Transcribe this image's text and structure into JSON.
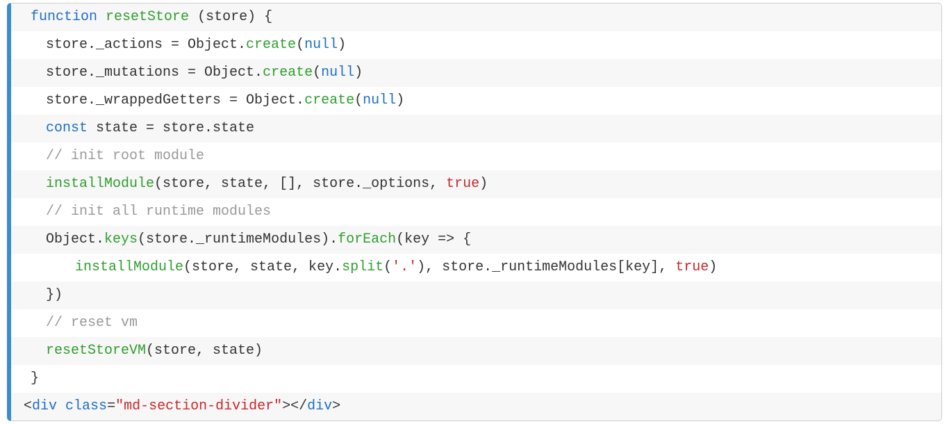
{
  "code": {
    "lines": [
      {
        "indent": "indent0",
        "tokens": [
          {
            "cls": "tok-keyword",
            "text": "function"
          },
          {
            "cls": "",
            "text": " "
          },
          {
            "cls": "tok-func",
            "text": "resetStore"
          },
          {
            "cls": "",
            "text": " ("
          },
          {
            "cls": "",
            "text": "store"
          },
          {
            "cls": "",
            "text": ") {"
          }
        ]
      },
      {
        "indent": "indent1",
        "tokens": [
          {
            "cls": "",
            "text": "store._actions = Object."
          },
          {
            "cls": "tok-func",
            "text": "create"
          },
          {
            "cls": "",
            "text": "("
          },
          {
            "cls": "tok-null",
            "text": "null"
          },
          {
            "cls": "",
            "text": ")"
          }
        ]
      },
      {
        "indent": "indent1",
        "tokens": [
          {
            "cls": "",
            "text": "store._mutations = Object."
          },
          {
            "cls": "tok-func",
            "text": "create"
          },
          {
            "cls": "",
            "text": "("
          },
          {
            "cls": "tok-null",
            "text": "null"
          },
          {
            "cls": "",
            "text": ")"
          }
        ]
      },
      {
        "indent": "indent1",
        "tokens": [
          {
            "cls": "",
            "text": "store._wrappedGetters = Object."
          },
          {
            "cls": "tok-func",
            "text": "create"
          },
          {
            "cls": "",
            "text": "("
          },
          {
            "cls": "tok-null",
            "text": "null"
          },
          {
            "cls": "",
            "text": ")"
          }
        ]
      },
      {
        "indent": "indent1",
        "tokens": [
          {
            "cls": "tok-keyword",
            "text": "const"
          },
          {
            "cls": "",
            "text": " state = store.state"
          }
        ]
      },
      {
        "indent": "indent1",
        "tokens": [
          {
            "cls": "tok-comment",
            "text": "// init root module"
          }
        ]
      },
      {
        "indent": "indent1",
        "tokens": [
          {
            "cls": "tok-func",
            "text": "installModule"
          },
          {
            "cls": "",
            "text": "(store, state, [], store._options, "
          },
          {
            "cls": "tok-bool",
            "text": "true"
          },
          {
            "cls": "",
            "text": ")"
          }
        ]
      },
      {
        "indent": "indent1",
        "tokens": [
          {
            "cls": "tok-comment",
            "text": "// init all runtime modules"
          }
        ]
      },
      {
        "indent": "indent1",
        "tokens": [
          {
            "cls": "",
            "text": "Object."
          },
          {
            "cls": "tok-func",
            "text": "keys"
          },
          {
            "cls": "",
            "text": "(store._runtimeModules)."
          },
          {
            "cls": "tok-func",
            "text": "forEach"
          },
          {
            "cls": "",
            "text": "(key => {"
          }
        ]
      },
      {
        "indent": "indent2",
        "tokens": [
          {
            "cls": "tok-func",
            "text": "installModule"
          },
          {
            "cls": "",
            "text": "(store, state, key."
          },
          {
            "cls": "tok-func",
            "text": "split"
          },
          {
            "cls": "",
            "text": "("
          },
          {
            "cls": "tok-string",
            "text": "'.'"
          },
          {
            "cls": "",
            "text": "), store._runtimeModules[key], "
          },
          {
            "cls": "tok-bool",
            "text": "true"
          },
          {
            "cls": "",
            "text": ")"
          }
        ]
      },
      {
        "indent": "indent1",
        "tokens": [
          {
            "cls": "",
            "text": "})"
          }
        ]
      },
      {
        "indent": "indent1",
        "tokens": [
          {
            "cls": "tok-comment",
            "text": "// reset vm"
          }
        ]
      },
      {
        "indent": "indent1",
        "tokens": [
          {
            "cls": "tok-func",
            "text": "resetStoreVM"
          },
          {
            "cls": "",
            "text": "(store, state)"
          }
        ]
      },
      {
        "indent": "indent0",
        "tokens": [
          {
            "cls": "",
            "text": "}"
          }
        ]
      },
      {
        "indent": "indent0-tag",
        "tokens": [
          {
            "cls": "tok-punc",
            "text": "<"
          },
          {
            "cls": "tok-tag",
            "text": "div"
          },
          {
            "cls": "",
            "text": " "
          },
          {
            "cls": "tok-attr",
            "text": "class"
          },
          {
            "cls": "tok-punc",
            "text": "="
          },
          {
            "cls": "tok-attrval",
            "text": "\"md-section-divider\""
          },
          {
            "cls": "tok-punc",
            "text": ">"
          },
          {
            "cls": "tok-punc",
            "text": "</"
          },
          {
            "cls": "tok-tag",
            "text": "div"
          },
          {
            "cls": "tok-punc",
            "text": ">"
          }
        ]
      }
    ]
  }
}
